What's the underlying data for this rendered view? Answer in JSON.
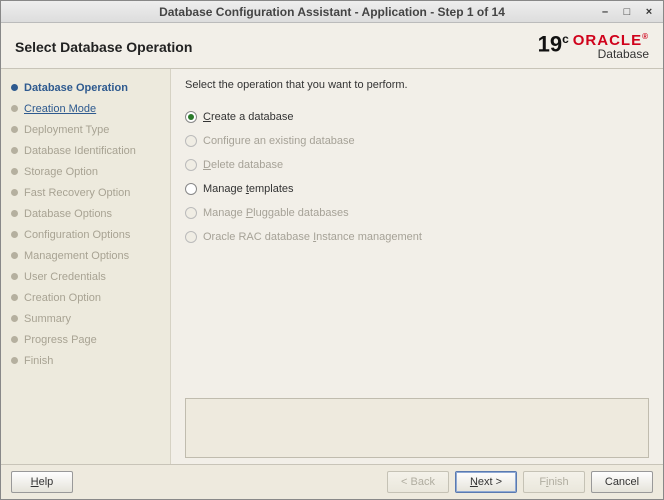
{
  "window": {
    "title": "Database Configuration Assistant - Application - Step 1 of 14"
  },
  "header": {
    "heading": "Select Database Operation",
    "brand_version": "19",
    "brand_version_sup": "c",
    "brand_name": "ORACLE",
    "brand_product": "Database"
  },
  "sidebar": {
    "steps": [
      {
        "label": "Database Operation",
        "state": "current"
      },
      {
        "label": "Creation Mode",
        "state": "link"
      },
      {
        "label": "Deployment Type",
        "state": "future"
      },
      {
        "label": "Database Identification",
        "state": "future"
      },
      {
        "label": "Storage Option",
        "state": "future"
      },
      {
        "label": "Fast Recovery Option",
        "state": "future"
      },
      {
        "label": "Database Options",
        "state": "future"
      },
      {
        "label": "Configuration Options",
        "state": "future"
      },
      {
        "label": "Management Options",
        "state": "future"
      },
      {
        "label": "User Credentials",
        "state": "future"
      },
      {
        "label": "Creation Option",
        "state": "future"
      },
      {
        "label": "Summary",
        "state": "future"
      },
      {
        "label": "Progress Page",
        "state": "future"
      },
      {
        "label": "Finish",
        "state": "future"
      }
    ]
  },
  "main": {
    "instruction": "Select the operation that you want to perform.",
    "options": [
      {
        "label": "Create a database",
        "mnemonic_index": 0,
        "enabled": true,
        "selected": true
      },
      {
        "label": "Configure an existing database",
        "mnemonic_index": -1,
        "enabled": false,
        "selected": false
      },
      {
        "label": "Delete database",
        "mnemonic_index": 0,
        "enabled": false,
        "selected": false
      },
      {
        "label": "Manage templates",
        "mnemonic_index": 7,
        "enabled": true,
        "selected": false
      },
      {
        "label": "Manage Pluggable databases",
        "mnemonic_index": 7,
        "enabled": false,
        "selected": false
      },
      {
        "label": "Oracle RAC database Instance management",
        "mnemonic_index": 20,
        "enabled": false,
        "selected": false
      }
    ]
  },
  "footer": {
    "help": "Help",
    "back": "< Back",
    "next": "Next >",
    "finish": "Finish",
    "cancel": "Cancel"
  }
}
